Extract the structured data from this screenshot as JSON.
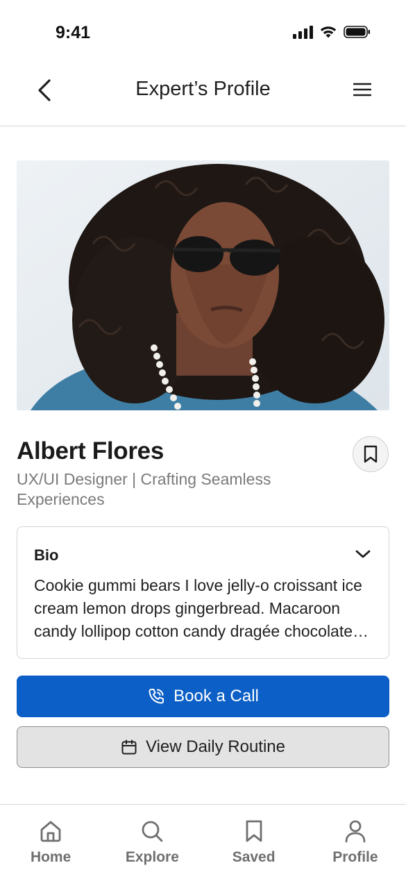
{
  "status_bar": {
    "time": "9:41"
  },
  "header": {
    "title": "Expert’s Profile"
  },
  "profile": {
    "name": "Albert Flores",
    "subtitle": "UX/UI Designer | Crafting Seamless Experiences"
  },
  "bio": {
    "title": "Bio",
    "text": "Cookie gummi bears I love jelly-o croissant ice cream lemon drops gingerbread. Macaroon candy lollipop cotton candy dragée chocolate cake."
  },
  "actions": {
    "book_call_label": "Book a Call",
    "view_routine_label": "View Daily Routine"
  },
  "tabs": [
    {
      "label": "Home",
      "icon": "home-icon"
    },
    {
      "label": "Explore",
      "icon": "search-icon"
    },
    {
      "label": "Saved",
      "icon": "bookmark-icon"
    },
    {
      "label": "Profile",
      "icon": "user-icon"
    }
  ],
  "colors": {
    "primary": "#0b5fc6",
    "secondary_bg": "#e3e3e3",
    "muted_text": "#7a7a7a",
    "tab_text": "#6f6f6f"
  }
}
